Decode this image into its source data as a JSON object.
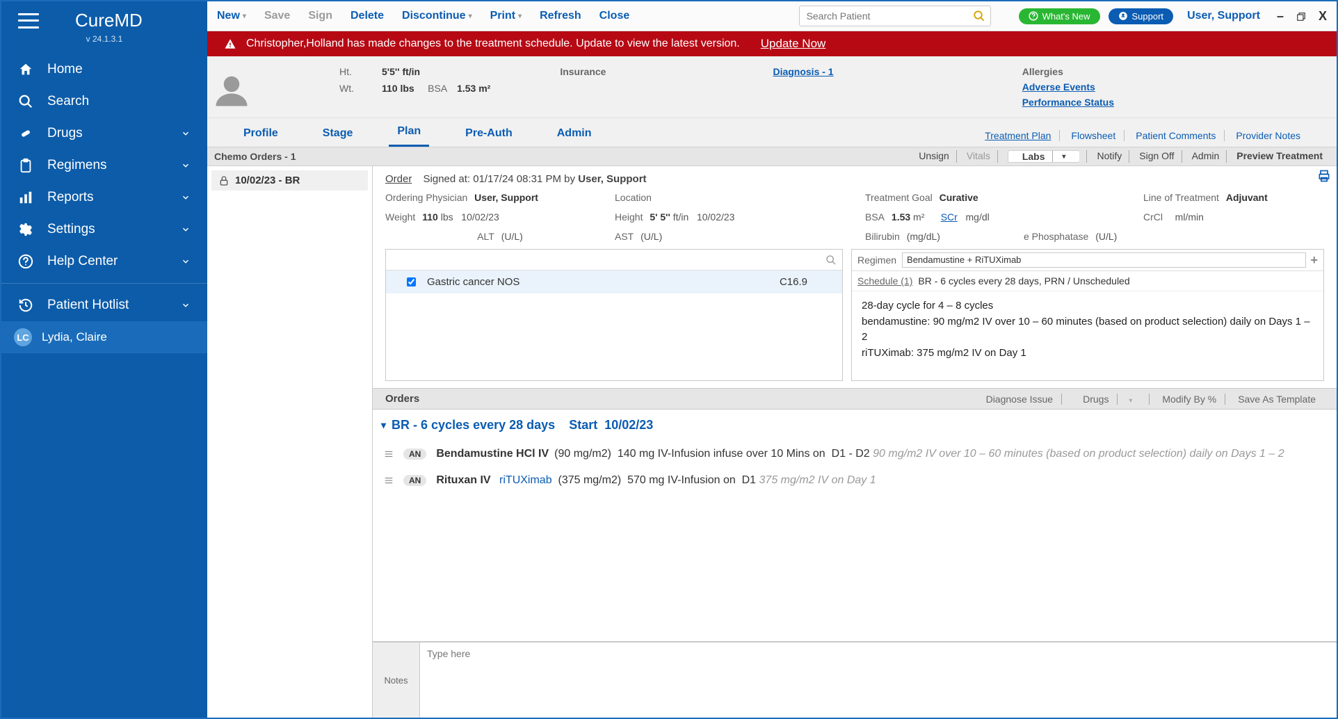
{
  "app": {
    "name": "CureMD",
    "version": "v 24.1.3.1"
  },
  "sidebar": {
    "items": [
      {
        "label": "Home"
      },
      {
        "label": "Search"
      },
      {
        "label": "Drugs",
        "arrow": true
      },
      {
        "label": "Regimens",
        "arrow": true
      },
      {
        "label": "Reports",
        "arrow": true
      },
      {
        "label": "Settings",
        "arrow": true
      },
      {
        "label": "Help Center",
        "arrow": true
      }
    ],
    "hotlist": {
      "label": "Patient Hotlist",
      "arrow": true
    },
    "patient": {
      "initials": "LC",
      "name": "Lydia, Claire"
    }
  },
  "toolbar": {
    "new": "New",
    "save": "Save",
    "sign": "Sign",
    "delete": "Delete",
    "discontinue": "Discontinue",
    "print": "Print",
    "refresh": "Refresh",
    "close": "Close",
    "search_placeholder": "Search Patient",
    "whats_new": "What's New",
    "support": "Support",
    "user": "User, Support"
  },
  "alert": {
    "text": "Christopher,Holland has made changes to the treatment schedule. Update to view the latest version.",
    "link": "Update Now"
  },
  "phead": {
    "ht_label": "Ht.",
    "ht": "5'5'' ft/in",
    "wt_label": "Wt.",
    "wt": "110 lbs",
    "bsa_label": "BSA",
    "bsa": "1.53 m²",
    "insurance": "Insurance",
    "diagnosis": "Diagnosis - 1",
    "allergies": "Allergies",
    "adverse": "Adverse Events",
    "perf": "Performance Status"
  },
  "tabs": {
    "list": [
      {
        "label": "Profile"
      },
      {
        "label": "Stage"
      },
      {
        "label": "Plan",
        "active": true
      },
      {
        "label": "Pre-Auth"
      },
      {
        "label": "Admin"
      }
    ],
    "right": [
      {
        "label": "Treatment Plan",
        "underline": true
      },
      {
        "label": "Flowsheet"
      },
      {
        "label": "Patient Comments"
      },
      {
        "label": "Provider Notes"
      }
    ]
  },
  "chemo": {
    "title": "Chemo Orders - 1",
    "right": [
      {
        "label": "Unsign"
      },
      {
        "label": "Vitals",
        "dim": true
      },
      {
        "label": "Labs",
        "caret": true,
        "pill": true
      },
      {
        "label": "Notify"
      },
      {
        "label": "Sign Off"
      },
      {
        "label": "Admin"
      },
      {
        "label": "Preview Treatment"
      }
    ],
    "left_item": {
      "date": "10/02/23 - BR"
    }
  },
  "order": {
    "label": "Order",
    "signed_prefix": "Signed at: ",
    "signed_at": "01/17/24 08:31 PM",
    "signed_by_prefix": " by ",
    "signed_by": "User, Support",
    "rows": {
      "ordering_phys_lbl": "Ordering Physician",
      "ordering_phys": "User, Support",
      "location_lbl": "Location",
      "location": "",
      "goal_lbl": "Treatment Goal",
      "goal": "Curative",
      "line_lbl": "Line of Treatment",
      "line": "Adjuvant",
      "weight_lbl": "Weight",
      "weight": "110",
      "weight_unit": "lbs",
      "weight_date": "10/02/23",
      "height_lbl": "Height",
      "height": "5' 5''",
      "height_unit": "ft/in",
      "height_date": "10/02/23",
      "bsa_lbl": "BSA",
      "bsa": "1.53",
      "bsa_unit": "m²",
      "scr_lbl": "SCr",
      "scr_unit": "mg/dl",
      "crcl_lbl": "CrCl",
      "crcl_unit": "ml/min",
      "alt_lbl": "ALT",
      "alt_unit": "(U/L)",
      "ast_lbl": "AST",
      "ast_unit": "(U/L)",
      "bili_lbl": "Bilirubin",
      "bili_unit": "(mg/dL)",
      "phos_lbl": "e Phosphatase",
      "phos_unit": "(U/L)"
    },
    "diagnosis": {
      "name": "Gastric cancer NOS",
      "code": "C16.9"
    },
    "regimen": {
      "label": "Regimen",
      "value": "Bendamustine + RiTUXimab",
      "schedule_label": "Schedule (1)",
      "schedule": "BR - 6 cycles every 28 days, PRN / Unscheduled",
      "body_line1": "28-day cycle for 4 – 8 cycles",
      "body_line2": "bendamustine: 90 mg/m2 IV over 10 – 60 minutes (based on product selection) daily on Days 1 – 2",
      "body_line3": "riTUXimab: 375 mg/m2 IV  on Day 1"
    }
  },
  "orders_bar": {
    "label": "Orders",
    "right": [
      {
        "label": "Diagnose Issue"
      },
      {
        "label": "Drugs",
        "caret": true
      },
      {
        "label": "Modify By %"
      },
      {
        "label": "Save As Template"
      }
    ]
  },
  "cycle": {
    "title": "BR - 6 cycles every 28 days",
    "start_label": "Start",
    "start_date": "10/02/23"
  },
  "order_lines": [
    {
      "an": "AN",
      "drug": "Bendamustine HCl IV",
      "dose": "(90 mg/m2)",
      "calc": "140 mg IV-Infusion infuse over 10 Mins on",
      "days": "D1  -   D2",
      "faded": "90 mg/m2 IV over 10 – 60 minutes (based on product selection) daily on Days 1 – 2"
    },
    {
      "an": "AN",
      "drug": "Rituxan IV",
      "link": "riTUXimab",
      "dose": "(375 mg/m2)",
      "calc": "570 mg IV-Infusion on",
      "days": "D1",
      "faded": "375 mg/m2 IV  on Day 1"
    }
  ],
  "notes": {
    "label": "Notes",
    "placeholder": "Type here"
  }
}
